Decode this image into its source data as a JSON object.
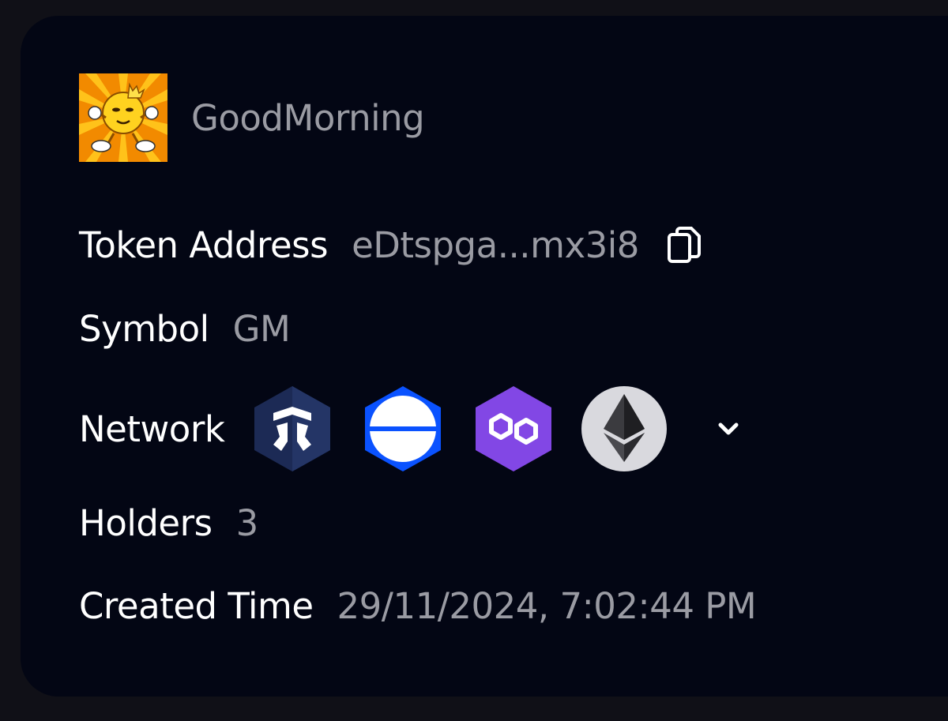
{
  "token": {
    "name": "GoodMorning",
    "avatar_icon": "sun-mascot-logo",
    "avatar_colors": {
      "ray_dark": "#f28a00",
      "ray_light": "#ffc21a",
      "face": "#ffd21f"
    }
  },
  "fields": {
    "address": {
      "label": "Token Address",
      "value": "eDtspga...mx3i8",
      "copy_icon": "copy-icon"
    },
    "symbol": {
      "label": "Symbol",
      "value": "GM"
    },
    "network": {
      "label": "Network",
      "icons": [
        "cronos-icon",
        "base-icon",
        "polygon-icon",
        "ethereum-icon"
      ],
      "colors": {
        "cronos": "#1c2a55",
        "base": "#0a52ff",
        "polygon": "#8247e5",
        "ethereum": "#d9d9de"
      },
      "expand_icon": "chevron-down-icon"
    },
    "holders": {
      "label": "Holders",
      "value": "3"
    },
    "created": {
      "label": "Created Time",
      "value": "29/11/2024, 7:02:44 PM"
    }
  },
  "theme": {
    "card_bg": "#030614",
    "page_bg": "#101017",
    "label_color": "#ffffff",
    "value_color": "#9a9ba3"
  }
}
